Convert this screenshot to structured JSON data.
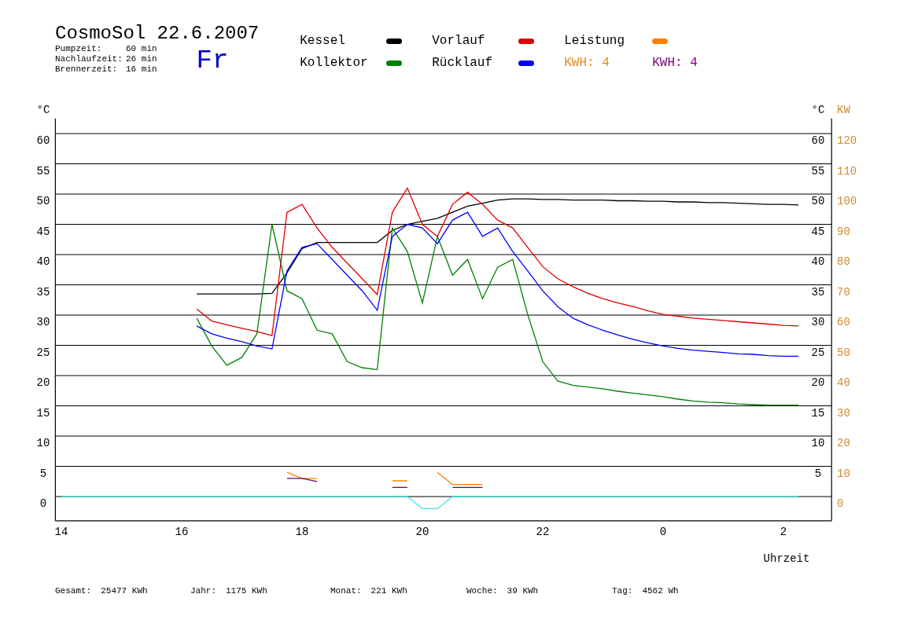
{
  "header": {
    "title": "CosmoSol 22.6.2007",
    "weekday": "Fr",
    "stats": [
      {
        "label": "Pumpzeit:",
        "value": "60 min"
      },
      {
        "label": "Nachlaufzeit:",
        "value": "26 min"
      },
      {
        "label": "Brennerzeit:",
        "value": "16 min"
      }
    ]
  },
  "legend_totals": [
    {
      "label": "KWH: 4",
      "color": "#e08a20"
    },
    {
      "label": "KWH: 4",
      "color": "#800080"
    }
  ],
  "chart": {
    "right_unit": "°C",
    "right_unit_kw": "KW",
    "right_celsius_labels": [
      "60",
      "55",
      "50",
      "45",
      "40",
      "35",
      "30",
      "25",
      "20",
      "15",
      "10",
      "5"
    ],
    "right_kw_labels": [
      "120",
      "110",
      "100",
      "90",
      "80",
      "70",
      "60",
      "50",
      "40",
      "30",
      "20",
      "10",
      "0"
    ],
    "next_day_tick_labels": [
      "0",
      "2"
    ],
    "chart_data": {
      "type": "line",
      "xlabel": "Uhrzeit",
      "ylabel": "°C",
      "xlim": [
        13.9,
        26.8
      ],
      "ylim": [
        -4,
        62.5
      ],
      "grid": true,
      "xticks": [
        14,
        16,
        18,
        20,
        22
      ],
      "yticks": [
        0,
        5,
        10,
        15,
        20,
        25,
        30,
        35,
        40,
        45,
        50,
        55,
        60
      ],
      "x": [
        14,
        14.25,
        14.5,
        14.75,
        15,
        15.25,
        15.5,
        15.75,
        16,
        16.25,
        16.5,
        16.75,
        17,
        17.25,
        17.5,
        17.75,
        18,
        18.25,
        18.5,
        18.75,
        19,
        19.25,
        19.5,
        19.75,
        20,
        20.25,
        20.5,
        20.75,
        21,
        21.25,
        21.5,
        21.75,
        22,
        22.25,
        22.5,
        22.75,
        23,
        23.25,
        23.5,
        23.75,
        24,
        24.25,
        24.5,
        24.75,
        25,
        25.25,
        25.5,
        25.75,
        26,
        26.25
      ],
      "series": [
        {
          "name": "Kessel",
          "color": "#000000",
          "values": [
            null,
            null,
            null,
            null,
            null,
            null,
            null,
            null,
            null,
            33.5,
            33.5,
            33.5,
            33.5,
            33.5,
            33.6,
            37,
            41,
            42,
            42,
            42,
            42,
            42,
            44,
            45,
            45.5,
            46,
            47,
            48,
            48.5,
            49,
            49.2,
            49.2,
            49.1,
            49.1,
            49,
            49,
            49,
            48.9,
            48.9,
            48.8,
            48.8,
            48.7,
            48.7,
            48.6,
            48.6,
            48.5,
            48.4,
            48.3,
            48.3,
            48.2
          ]
        },
        {
          "name": "Vorlauf",
          "color": "#e00000",
          "values": [
            null,
            null,
            null,
            null,
            null,
            null,
            null,
            null,
            null,
            31,
            29,
            28.4,
            27.8,
            27.3,
            26.6,
            47,
            48.3,
            44.4,
            41.2,
            38.6,
            36,
            33.4,
            47,
            51,
            45,
            43,
            48.3,
            50.3,
            48.3,
            45.7,
            44.4,
            41.2,
            38,
            36,
            34.7,
            33.6,
            32.7,
            32,
            31.4,
            30.7,
            30.1,
            29.8,
            29.5,
            29.3,
            29.1,
            28.9,
            28.7,
            28.5,
            28.3,
            28.2
          ]
        },
        {
          "name": "Leistung",
          "color": "#ff8000",
          "values": [
            null,
            null,
            null,
            null,
            null,
            null,
            null,
            null,
            null,
            null,
            null,
            null,
            null,
            null,
            null,
            4,
            3,
            3,
            null,
            null,
            null,
            null,
            2.6,
            2.6,
            null,
            4,
            2,
            2,
            2,
            null,
            null,
            null,
            null,
            null,
            null,
            null,
            null,
            null,
            null,
            null,
            null,
            null,
            null,
            null,
            null,
            null,
            null,
            null,
            null,
            null
          ]
        },
        {
          "name": "Kollektor",
          "color": "#008000",
          "values": [
            null,
            null,
            null,
            null,
            null,
            null,
            null,
            null,
            null,
            29.5,
            24.9,
            21.7,
            23,
            26.9,
            45,
            34,
            32.7,
            27.5,
            26.9,
            22.3,
            21.3,
            21,
            44.4,
            40.5,
            32,
            43,
            36.6,
            39.2,
            32.7,
            37.9,
            39.2,
            30.1,
            22.3,
            19.1,
            18.4,
            18.1,
            17.8,
            17.4,
            17.1,
            16.8,
            16.5,
            16.1,
            15.8,
            15.6,
            15.5,
            15.3,
            15.2,
            15.1,
            15.1,
            15.1
          ]
        },
        {
          "name": "Rücklauf",
          "color": "#0000ff",
          "values": [
            null,
            null,
            null,
            null,
            null,
            null,
            null,
            null,
            null,
            28.2,
            26.9,
            26.2,
            25.6,
            24.9,
            24.4,
            37.3,
            41.2,
            41.8,
            39.2,
            36.6,
            34,
            30.8,
            43,
            45,
            44.4,
            41.8,
            45.7,
            47,
            43,
            44.4,
            40.5,
            37.3,
            34,
            31.4,
            29.5,
            28.4,
            27.5,
            26.7,
            26,
            25.4,
            24.9,
            24.5,
            24.2,
            24,
            23.8,
            23.6,
            23.5,
            23.3,
            23.2,
            23.2
          ]
        },
        {
          "color": "#700070",
          "values": [
            null,
            null,
            null,
            null,
            null,
            null,
            null,
            null,
            null,
            null,
            null,
            null,
            null,
            null,
            null,
            3,
            3,
            2.5,
            null,
            null,
            null,
            null,
            1.5,
            1.5,
            null,
            null,
            1.5,
            1.5,
            1.5,
            null,
            null,
            null,
            null,
            null,
            null,
            null,
            null,
            null,
            null,
            null,
            null,
            null,
            null,
            null,
            null,
            null,
            null,
            null,
            null,
            null
          ]
        },
        {
          "color": "#40e0e0",
          "values": [
            0,
            0,
            0,
            0,
            0,
            0,
            0,
            0,
            0,
            0,
            0,
            0,
            0,
            0,
            0,
            0,
            0,
            0,
            0,
            0,
            0,
            0,
            0,
            0,
            -2,
            -2,
            0,
            0,
            0,
            0,
            0,
            0,
            0,
            0,
            0,
            0,
            0,
            0,
            0,
            0,
            0,
            0,
            0,
            0,
            0,
            0,
            0,
            0,
            0,
            0
          ]
        }
      ]
    }
  },
  "footer": [
    {
      "label": "Gesamt:",
      "value": "25477 KWh"
    },
    {
      "label": "Jahr:",
      "value": "1175 KWh"
    },
    {
      "label": "Monat:",
      "value": "221 KWh"
    },
    {
      "label": "Woche:",
      "value": "39 KWh"
    },
    {
      "label": "Tag:",
      "value": "4562 Wh"
    }
  ]
}
